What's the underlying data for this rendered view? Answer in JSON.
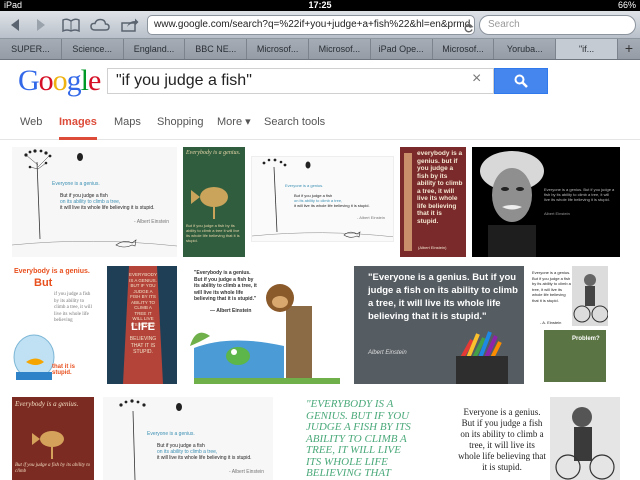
{
  "status": {
    "carrier": "iPad",
    "time": "17:25",
    "battery": "66%"
  },
  "browser": {
    "url": "www.google.com/search?q=%22if+you+judge+a+fish%22&hl=en&prmd",
    "search_placeholder": "Search",
    "tabs": [
      "SUPER...",
      "Science...",
      "England...",
      "BBC NE...",
      "Microsof...",
      "Microsof...",
      "iPad Ope...",
      "Microsof...",
      "Yoruba...",
      "\"if..."
    ],
    "active_tab": 9,
    "add_tab": "+"
  },
  "google": {
    "logo_letters": [
      "G",
      "o",
      "o",
      "g",
      "l",
      "e"
    ],
    "logo_colors": [
      "#3369e8",
      "#d50f25",
      "#eeb211",
      "#3369e8",
      "#009925",
      "#d50f25"
    ],
    "query": "\"if you judge a fish\"",
    "clear": "×",
    "nav": [
      "Web",
      "Images",
      "Maps",
      "Shopping",
      "More ▾",
      "Search tools"
    ],
    "active_nav": "Images"
  },
  "images": {
    "img1": {
      "l1": "Everyone is a genius.",
      "l2": "But if you judge a fish",
      "l3": "on its ability to climb a tree,",
      "l4": "it will live its whole life believing it is stupid.",
      "l5": "- Albert Einstein"
    },
    "img2": {
      "top": "Everybody is a genius.",
      "bottom": "But if you judge a fish by its ability to climb a tree it will live its whole life believing that it is stupid."
    },
    "img3": {
      "l1": "Everyone is a genius.",
      "l2": "But if you judge a fish",
      "l3": "on its ability to climb a tree,",
      "l4": "it will live its whole life believing it is stupid.",
      "l5": "- Albert Einstein"
    },
    "img4": {
      "text": "everybody is a genius. but if you judge a fish by its ability to climb a tree, it will live its whole life believing that it is stupid.",
      "credit": "(Albert Einstein)"
    },
    "img5": {
      "text": "Everyone is a genius. But if you judge a fish by its ability to climb a tree, it will live its whole life believing it is stupid.",
      "credit": "Albert Einstein"
    },
    "img6": {
      "l1": "Everybody is a genius.",
      "l2": "But",
      "l3": "if you judge a fish by its ability to climb a tree, it will live its whole life believing",
      "l4": "that it is stupid."
    },
    "img7": {
      "top": "EVERYBODY IS A GENIUS. BUT IF YOU JUDGE A FISH BY ITS ABILITY TO CLIMB A TREE IT WILL LIVE ITS WHOLE",
      "mid": "LIFE",
      "bot": "BELIEVING THAT IT IS STUPID."
    },
    "img8": {
      "text": "\"Everybody is a genius. But if you judge a fish by its ability to climb a tree, it will live its whole life believing that it is stupid.\"",
      "credit": "— Albert Einstein"
    },
    "img9": {
      "text": "\"Everyone is a genius. But if you judge a fish on its ability to climb a tree, it will live its whole life believing that it is stupid.\"",
      "credit": "Albert Einstein"
    },
    "img10": {
      "text": "Everyone is a genius. But if you judge a fish by its ability to climb a tree, it will live its whole life believing that it is stupid.",
      "credit": "- A. Einstein",
      "problem": "Problem?"
    },
    "img11": {
      "top": "Everybody is a genius.",
      "bottom": "But if you judge a fish by its ability to climb"
    },
    "img12": {
      "l1": "Everyone is a genius.",
      "l2": "But if you judge a fish",
      "l3": "on its ability to climb a tree,",
      "l4": "it will live its whole life believing it is stupid.",
      "l5": "- Albert Einstein"
    },
    "img13": {
      "text": "\"EVERYBODY IS A GENIUS. BUT IF YOU JUDGE A FISH BY ITS ABILITY TO CLIMB A TREE, IT WILL LIVE ITS WHOLE LIFE BELIEVING THAT"
    },
    "img14": {
      "text": "Everyone is a genius. But if you judge a fish on its ability to climb a tree, it will live its whole life believing that it is stupid."
    }
  },
  "colors": {
    "accent_red": "#dd4b39",
    "search_blue": "#4585ee"
  }
}
